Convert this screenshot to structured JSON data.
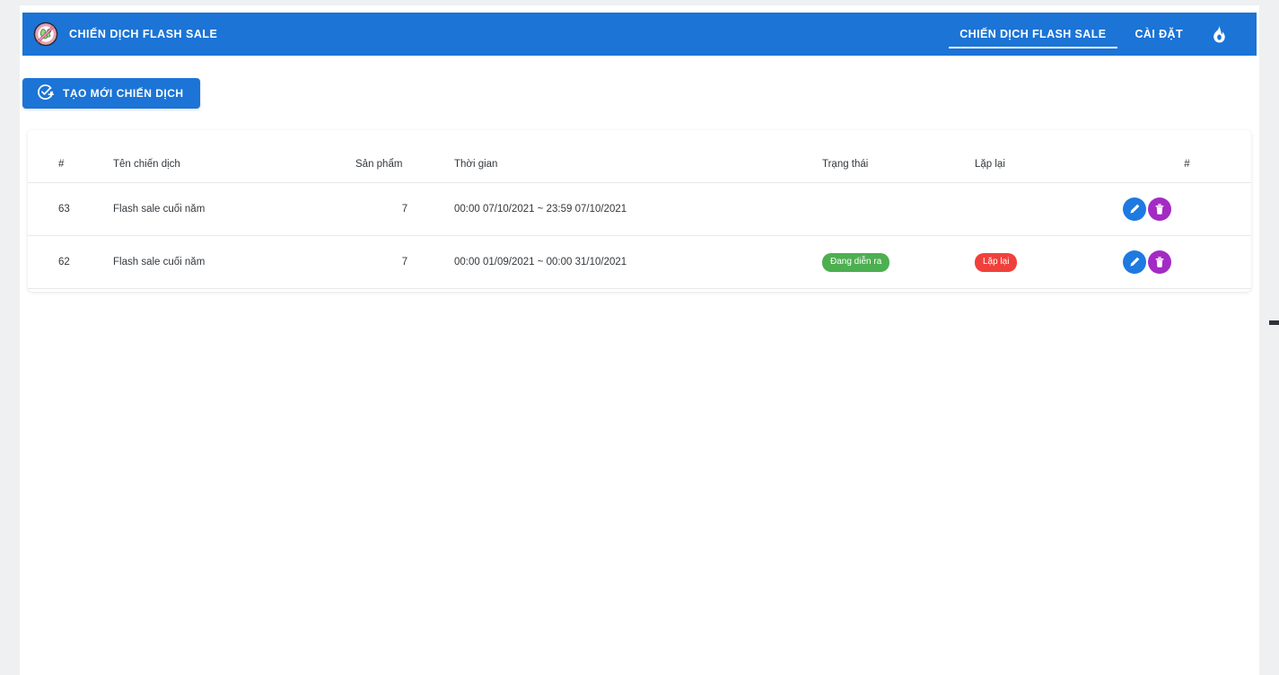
{
  "header": {
    "logo_icon": "no-germ-icon",
    "title": "CHIẾN DỊCH FLASH SALE",
    "nav": [
      {
        "label": "CHIẾN DỊCH FLASH SALE",
        "active": true
      },
      {
        "label": "CÀI ĐẶT",
        "active": false
      }
    ],
    "nav_icon": "flame-icon",
    "background_color": "#1b74d6"
  },
  "toolbar": {
    "create_label": "TẠO MỚI CHIẾN DỊCH",
    "create_icon": "check-circle-plus-icon"
  },
  "table": {
    "columns": [
      "#",
      "Tên chiến dịch",
      "Sản phẩm",
      "Thời gian",
      "Trạng thái",
      "Lặp lại",
      "#"
    ],
    "rows": [
      {
        "id": "63",
        "name": "Flash sale cuối năm",
        "product": "7",
        "time": "00:00 07/10/2021 ~ 23:59 07/10/2021",
        "status": "",
        "repeat": "",
        "edit_icon": "pencil-icon",
        "delete_icon": "trash-icon"
      },
      {
        "id": "62",
        "name": "Flash sale cuối năm",
        "product": "7",
        "time": "00:00 01/09/2021 ~ 00:00 31/10/2021",
        "status": "Đang diễn ra",
        "repeat": "Lặp lại",
        "edit_icon": "pencil-icon",
        "delete_icon": "trash-icon"
      }
    ]
  },
  "colors": {
    "primary_blue": "#1b74d6",
    "status_green": "#4caf50",
    "repeat_red": "#f1403b",
    "edit_blue": "#1e7ae0",
    "delete_purple": "#a32bc4",
    "page_gray": "#eff0f2"
  }
}
